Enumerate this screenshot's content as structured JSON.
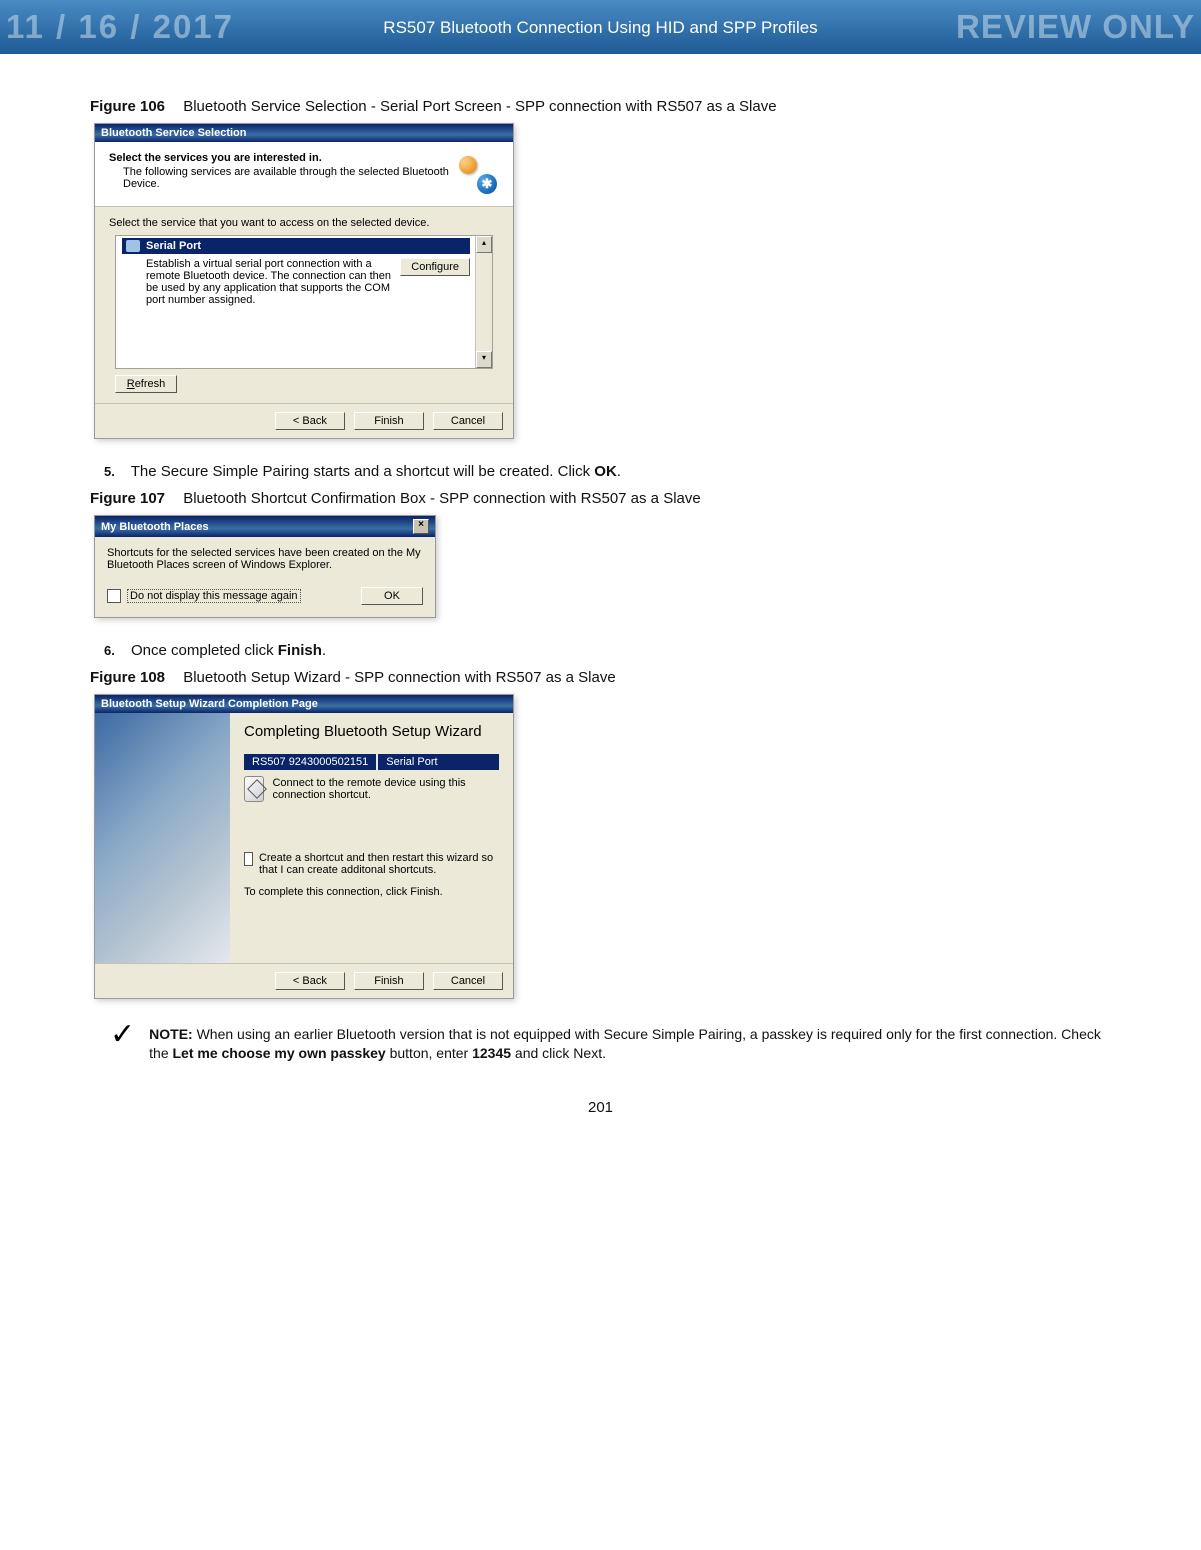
{
  "header": {
    "stamp_left": "11 / 16 / 2017",
    "stamp_right": "REVIEW ONLY",
    "title": "RS507 Bluetooth Connection Using HID and SPP Profiles"
  },
  "fig106": {
    "label": "Figure 106",
    "caption": "Bluetooth Service Selection - Serial Port Screen - SPP connection with RS507 as a Slave"
  },
  "dlg1": {
    "title": "Bluetooth Service Selection",
    "head_bold": "Select the services you are interested in.",
    "head_sub": "The following services are available through the selected Bluetooth Device.",
    "mid_text": "Select the service that you want to access on the selected device.",
    "svc_title": "Serial Port",
    "svc_desc": "Establish a virtual serial port connection with a remote Bluetooth device. The connection can then be used by any application that supports the COM port number assigned.",
    "configure": "Configure",
    "refresh": "Refresh",
    "back": "< Back",
    "finish": "Finish",
    "cancel": "Cancel"
  },
  "step5": {
    "num": "5.",
    "text_1": "The Secure Simple Pairing starts and a shortcut will be created. Click ",
    "text_bold": "OK",
    "text_2": "."
  },
  "fig107": {
    "label": "Figure 107",
    "caption": "Bluetooth Shortcut Confirmation Box - SPP connection with RS507 as a Slave"
  },
  "dlg2": {
    "title": "My Bluetooth Places",
    "msg": "Shortcuts for the selected services have been created on the My Bluetooth Places screen of Windows Explorer.",
    "chk_label": "Do not display this message again",
    "ok": "OK"
  },
  "step6": {
    "num": "6.",
    "text_1": "Once completed click ",
    "text_bold": "Finish",
    "text_2": "."
  },
  "fig108": {
    "label": "Figure 108",
    "caption": "Bluetooth Setup Wizard - SPP connection with RS507 as a Slave"
  },
  "dlg3": {
    "title": "Bluetooth Setup Wizard Completion Page",
    "big": "Completing Bluetooth Setup Wizard",
    "dev_id": "RS507 9243000502151",
    "dev_svc": "Serial Port",
    "shortcut_note": "Connect to the remote device using this connection shortcut.",
    "chk_text": "Create a shortcut and then restart this wizard so that I can create additonal shortcuts.",
    "finish_note": "To complete this connection, click Finish.",
    "back": "< Back",
    "finish": "Finish",
    "cancel": "Cancel"
  },
  "note": {
    "label": "NOTE:",
    "text_1": " When using an earlier Bluetooth version that is not equipped with Secure Simple Pairing, a passkey is required only for the first connection. Check the ",
    "bold1": "Let me choose my own passkey",
    "text_2": " button, enter ",
    "bold2": "12345",
    "text_3": " and click Next."
  },
  "page_num": "201"
}
